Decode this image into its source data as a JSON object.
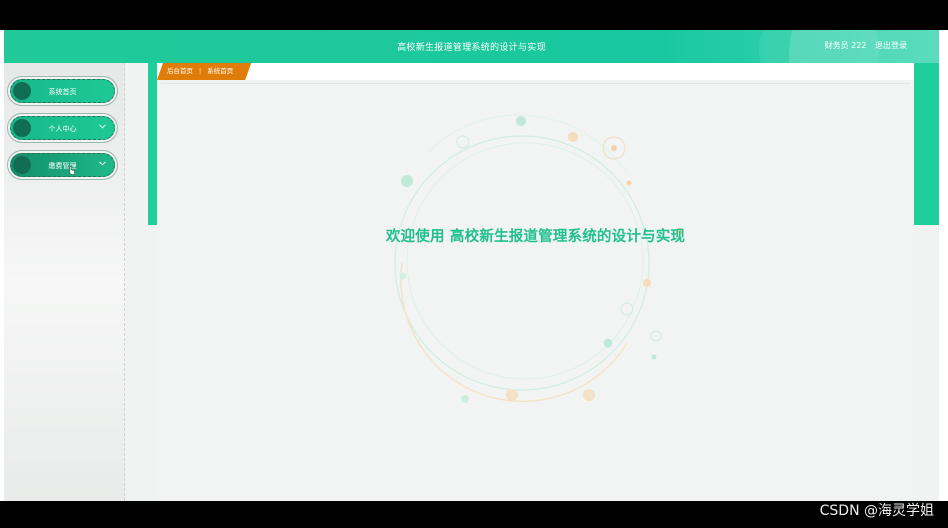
{
  "header": {
    "title": "高校新生报道管理系统的设计与实现",
    "user_label": "财务员 222",
    "logout_label": "退出登录"
  },
  "sidebar": {
    "items": [
      {
        "label": "系统首页"
      },
      {
        "label": "个人中心",
        "chevron": "chevron-down-icon"
      },
      {
        "label": "缴费管理",
        "chevron": "chevron-down-icon"
      }
    ]
  },
  "breadcrumb": {
    "home": "后台首页",
    "current": "系统首页"
  },
  "main": {
    "welcome": "欢迎使用 高校新生报道管理系统的设计与实现"
  },
  "watermark": "CSDN @海灵学姐",
  "colors": {
    "primary": "#20c997",
    "breadcrumb": "#e07d0a",
    "menu_dot": "#116e55"
  }
}
